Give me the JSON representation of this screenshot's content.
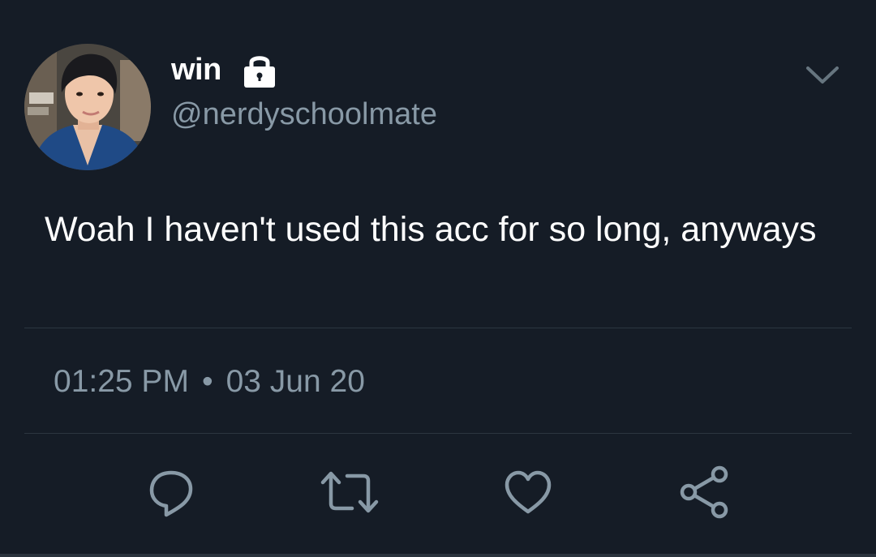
{
  "user": {
    "display_name": "win",
    "handle": "@nerdyschoolmate",
    "protected_icon": "lock-icon",
    "avatar": "profile-photo"
  },
  "tweet": {
    "text": "Woah I haven't used this acc for so long, anyways",
    "time": "01:25 PM",
    "separator": "•",
    "date": "03 Jun 20"
  },
  "actions": {
    "reply_icon": "comment-icon",
    "retweet_icon": "retweet-icon",
    "like_icon": "heart-icon",
    "share_icon": "share-icon"
  },
  "menu_icon": "chevron-down-icon",
  "colors": {
    "background": "#151c26",
    "primary_text": "#ffffff",
    "secondary_text": "#8899a6",
    "divider": "#2c3640"
  }
}
